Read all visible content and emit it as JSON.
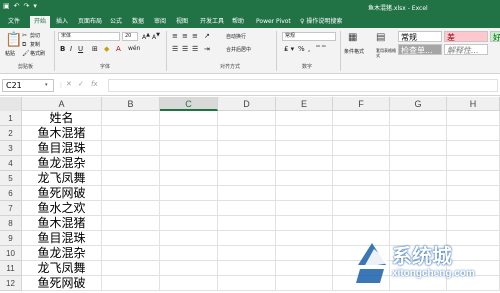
{
  "window": {
    "title": "鱼木混猪.xlsx - Excel"
  },
  "tabs": [
    {
      "label": "文件",
      "active": false
    },
    {
      "label": "开始",
      "active": true
    },
    {
      "label": "插入",
      "active": false
    },
    {
      "label": "页面布局",
      "active": false
    },
    {
      "label": "公式",
      "active": false
    },
    {
      "label": "数据",
      "active": false
    },
    {
      "label": "审阅",
      "active": false
    },
    {
      "label": "视图",
      "active": false
    },
    {
      "label": "开发工具",
      "active": false
    },
    {
      "label": "帮助",
      "active": false
    },
    {
      "label": "Power Pivot",
      "active": false
    },
    {
      "label": "操作说明搜索",
      "active": false
    }
  ],
  "ribbon": {
    "clipboard": {
      "paste": "粘贴",
      "cut": "剪切",
      "copy": "复制",
      "format_painter": "格式刷",
      "group": "剪贴板"
    },
    "font": {
      "name": "宋体",
      "size": "20",
      "group": "字体"
    },
    "alignment": {
      "wrap": "自动换行",
      "merge": "合并后居中",
      "group": "对齐方式"
    },
    "number": {
      "format": "常规",
      "group": "数字"
    },
    "styles": {
      "conditional": "条件格式",
      "table": "套用表格格式",
      "normal": "常规",
      "bad": "差",
      "good": "好",
      "check": "检查单...",
      "explain": "解释性..."
    }
  },
  "formula_bar": {
    "name_box": "C21",
    "content": ""
  },
  "grid": {
    "columns": [
      "A",
      "B",
      "C",
      "D",
      "E",
      "F",
      "G",
      "H"
    ],
    "selected_column": "C",
    "rows": [
      {
        "num": "1",
        "a": "姓名"
      },
      {
        "num": "2",
        "a": "鱼木混猪"
      },
      {
        "num": "3",
        "a": "鱼目混珠"
      },
      {
        "num": "4",
        "a": "鱼龙混杂"
      },
      {
        "num": "5",
        "a": "龙飞凤舞"
      },
      {
        "num": "6",
        "a": "鱼死网破"
      },
      {
        "num": "7",
        "a": "鱼水之欢"
      },
      {
        "num": "8",
        "a": "鱼木混猪"
      },
      {
        "num": "9",
        "a": "鱼目混珠"
      },
      {
        "num": "10",
        "a": "鱼龙混杂"
      },
      {
        "num": "11",
        "a": "龙飞凤舞"
      },
      {
        "num": "12",
        "a": "鱼死网破"
      }
    ]
  },
  "watermark": {
    "brand": "系统城",
    "url": "xitongcheng.com"
  },
  "colors": {
    "accent": "#217346",
    "watermark": "#1a5fa8"
  }
}
